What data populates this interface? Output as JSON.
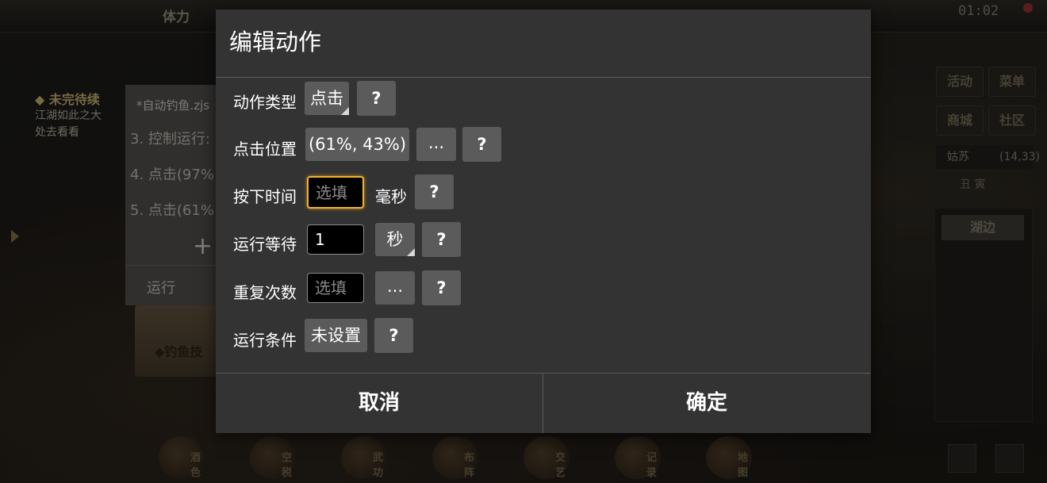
{
  "background": {
    "topbar_label": "体力",
    "clock": "01:02",
    "quest_head": "◆ 未完待续",
    "quest_line1": "江湖如此之大",
    "quest_line2": "处去看看",
    "editor_filename": "*自动钓鱼.zjs",
    "editor_lines": [
      "3. 控制运行:",
      "4. 点击(97%",
      "5. 点击(61%"
    ],
    "editor_run": "运行",
    "scroll_label": "◆钓鱼技",
    "right_buttons": [
      "活动",
      "菜单",
      "商城",
      "社区"
    ],
    "location_name": "姑苏",
    "location_coord": "(14,33)",
    "location_tabs": "丑  寅",
    "lake_label": "湖边",
    "bottom_labels": [
      "酒色",
      "空税",
      "武功",
      "布阵",
      "交艺",
      "记录",
      "地图"
    ]
  },
  "dialog": {
    "title": "编辑动作",
    "rows": {
      "action_type": {
        "label": "动作类型",
        "value": "点击",
        "help": "?"
      },
      "click_position": {
        "label": "点击位置",
        "value": "(61%, 43%)",
        "more": "...",
        "help": "?"
      },
      "press_time": {
        "label": "按下时间",
        "placeholder": "选填",
        "unit": "毫秒",
        "help": "?"
      },
      "wait": {
        "label": "运行等待",
        "value": "1",
        "unit": "秒",
        "help": "?"
      },
      "repeat": {
        "label": "重复次数",
        "placeholder": "选填",
        "more": "...",
        "help": "?"
      },
      "condition": {
        "label": "运行条件",
        "value": "未设置",
        "help": "?"
      }
    },
    "cancel": "取消",
    "confirm": "确定"
  }
}
